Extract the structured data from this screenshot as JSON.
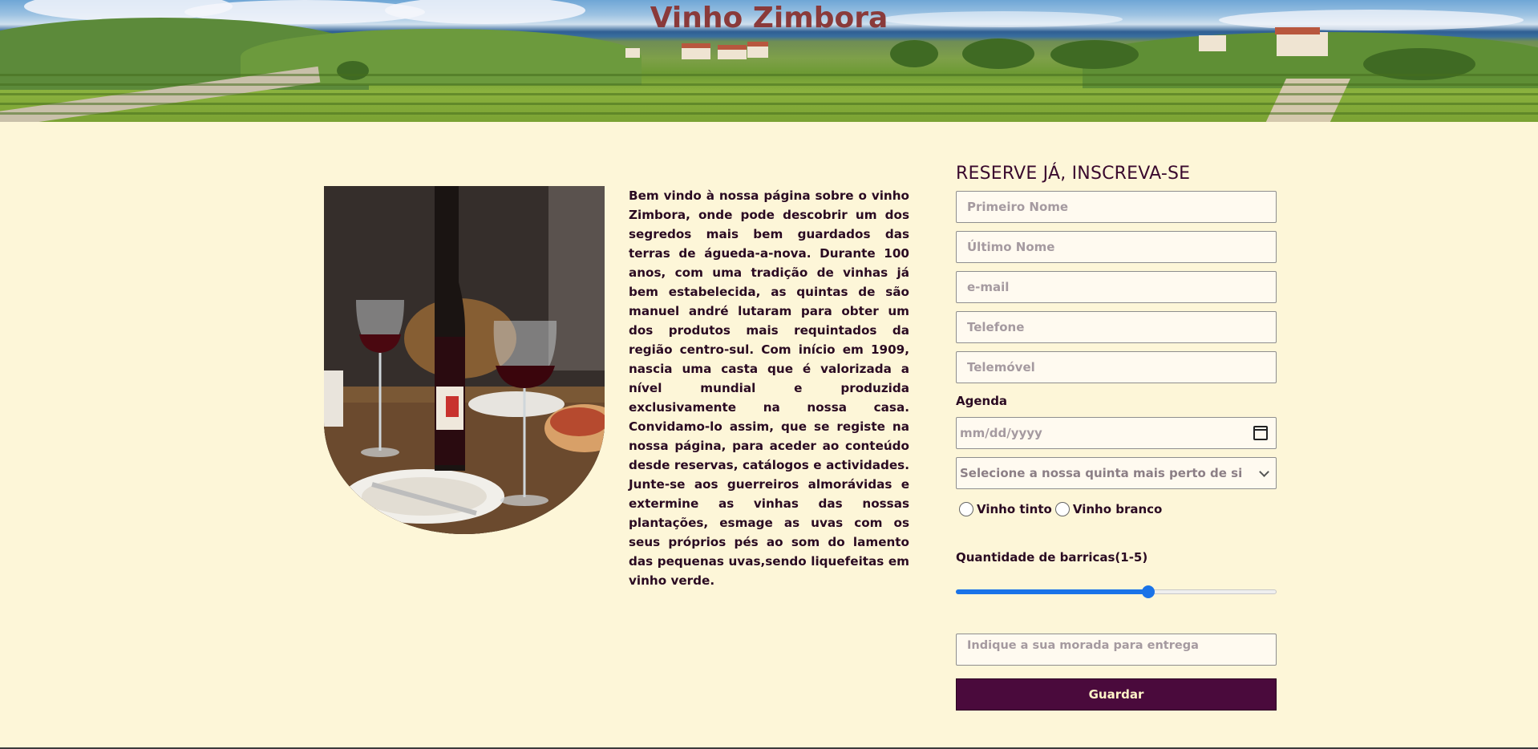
{
  "header": {
    "title": "Vinho Zimbora"
  },
  "intro_text": "Bem vindo à nossa página sobre o vinho Zimbora, onde pode descobrir um dos segredos mais bem guardados das terras de águeda-a-nova. Durante 100 anos, com uma tradição de vinhas já bem estabelecida, as quintas de são manuel andré lutaram para obter um dos produtos mais requintados da região centro-sul. Com início em 1909, nascia uma casta que é valorizada a nível mundial e produzida exclusivamente na nossa casa. Convidamo-lo assim, que se registe na nossa página, para aceder ao conteúdo desde reservas, catálogos e actividades. Junte-se aos guerreiros almorávidas e extermine as vinhas das nossas plantações, esmage as uvas com os seus próprios pés ao som do lamento das pequenas uvas,sendo liquefeitas em vinho verde.",
  "form": {
    "heading": "RESERVE JÁ, INSCREVA-SE",
    "first_name_placeholder": "Primeiro Nome",
    "last_name_placeholder": "Último Nome",
    "email_placeholder": "e-mail",
    "phone_placeholder": "Telefone",
    "mobile_placeholder": "Telemóvel",
    "agenda_label": "Agenda",
    "date_placeholder": "mm/dd/yyyy",
    "select_value": "Selecione a nossa quinta mais perto de si",
    "radio_red_label": "Vinho tinto",
    "radio_white_label": "Vinho branco",
    "barrels_label": "Quantidade de barricas(1-5)",
    "barrels_slider": {
      "min": 1,
      "max": 5,
      "value": 3.4
    },
    "address_placeholder": "Indique a sua morada para entrega",
    "save_label": "Guardar"
  },
  "icons": {
    "calendar": "calendar-icon",
    "dropdown": "chevron-down-icon",
    "radio": "radio-unchecked"
  },
  "colors": {
    "background": "#fdf6d8",
    "title": "#8a3a3a",
    "text": "#2a0a22",
    "button_bg": "#4a0a3c",
    "button_text": "#fff4c8",
    "slider_accent": "#1a73e8"
  }
}
